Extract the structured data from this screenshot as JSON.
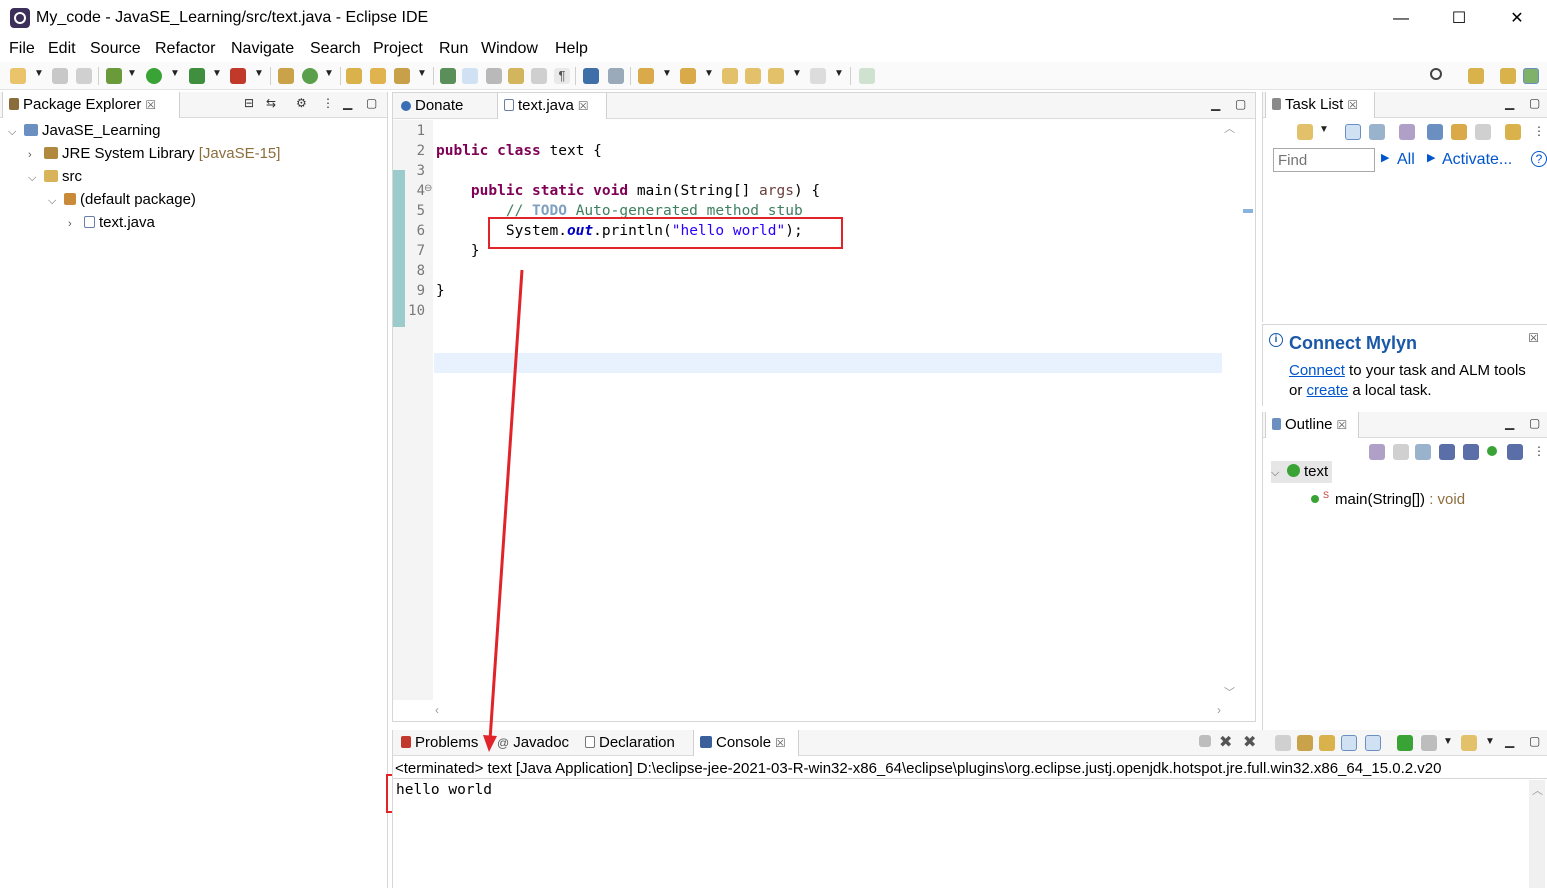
{
  "window": {
    "title": "My_code - JavaSE_Learning/src/text.java - Eclipse IDE",
    "minimize": "—",
    "maximize": "☐",
    "close": "✕"
  },
  "menu": [
    "File",
    "Edit",
    "Source",
    "Refactor",
    "Navigate",
    "Search",
    "Project",
    "Run",
    "Window",
    "Help"
  ],
  "package_explorer": {
    "title": "Package Explorer",
    "project": "JavaSE_Learning",
    "jre": "JRE System Library",
    "jre_version": "[JavaSE-15]",
    "src": "src",
    "package": "(default package)",
    "file": "text.java"
  },
  "editor": {
    "tabs": [
      "Donate",
      "text.java"
    ],
    "active_tab": "text.java",
    "line_numbers": [
      "1",
      "2",
      "3",
      "4",
      "5",
      "6",
      "7",
      "8",
      "9",
      "10"
    ],
    "code": {
      "l2_kw1": "public",
      "l2_kw2": "class",
      "l2_rest": " text {",
      "l4_kw1": "public",
      "l4_kw2": "static",
      "l4_kw3": "void",
      "l4_mid": " main(String[] ",
      "l4_param": "args",
      "l4_end": ") {",
      "l5_prefix": "// ",
      "l5_todo": "TODO",
      "l5_rest": " Auto-generated method stub",
      "l6_a": "System.",
      "l6_field": "out",
      "l6_b": ".println(",
      "l6_str": "\"hello world\"",
      "l6_c": ");",
      "l7": "}",
      "l9": "}"
    }
  },
  "task_list": {
    "title": "Task List",
    "find_placeholder": "Find",
    "all": "All",
    "activate": "Activate...",
    "help": "?"
  },
  "mylyn": {
    "title": "Connect Mylyn",
    "connect": "Connect",
    "text1": " to your task and ALM tools or ",
    "create": "create",
    "text2": " a local task."
  },
  "outline": {
    "title": "Outline",
    "class_name": "text",
    "method": "main(String[])",
    "return_type": " : void"
  },
  "console": {
    "tabs": [
      "Problems",
      "Javadoc",
      "Declaration",
      "Console"
    ],
    "status": "<terminated> text [Java Application] D:\\eclipse-jee-2021-03-R-win32-x86_64\\eclipse\\plugins\\org.eclipse.justj.openjdk.hotspot.jre.full.win32.x86_64_15.0.2.v20",
    "output": "hello world"
  },
  "colors": {
    "keyword": "#7f0055",
    "string": "#2a00ff",
    "comment": "#3f7f5f",
    "annotation_red": "#e0242a",
    "link": "#0055cc"
  }
}
